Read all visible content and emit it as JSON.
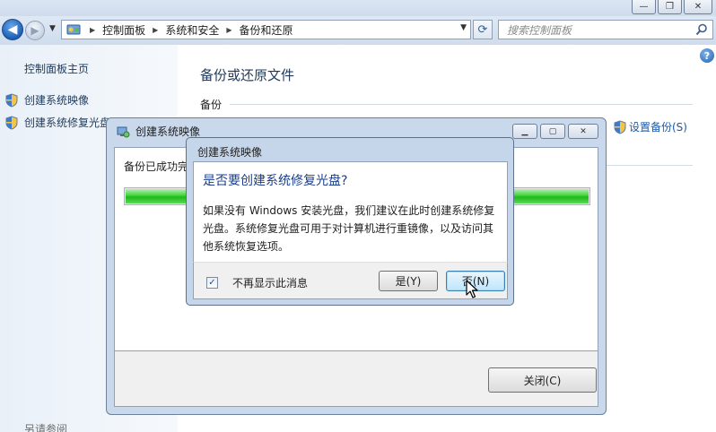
{
  "window": {
    "controls": {
      "minimize": "—",
      "maximize": "❐",
      "close": "✕"
    }
  },
  "nav": {
    "breadcrumbs": [
      "控制面板",
      "系统和安全",
      "备份和还原"
    ],
    "search_placeholder": "搜索控制面板",
    "icons": [
      "back-arrow-icon",
      "forward-arrow-icon",
      "control-panel-icon",
      "refresh-icon",
      "search-icon",
      "help-icon"
    ]
  },
  "sidebar": {
    "home": "控制面板主页",
    "items": [
      {
        "label": "创建系统映像",
        "icon": "uac-shield-icon"
      },
      {
        "label": "创建系统修复光盘",
        "icon": "uac-shield-icon"
      }
    ],
    "see_also": "另请参阅"
  },
  "main": {
    "title": "备份或还原文件",
    "section": "备份",
    "setup_link": "设置备份(S)"
  },
  "progress_dialog": {
    "title": "创建系统映像",
    "status": "备份已成功完",
    "progress": 1.0,
    "close_button": "关闭(C)"
  },
  "confirm_dialog": {
    "title": "创建系统映像",
    "heading": "是否要创建系统修复光盘?",
    "message": "如果没有 Windows 安装光盘，我们建议在此时创建系统修复光盘。系统修复光盘可用于对计算机进行重镜像，以及访问其他系统恢复选项。",
    "checkbox_label": "不再显示此消息",
    "checkbox_checked": true,
    "yes_button": "是(Y)",
    "no_button": "否(N)"
  },
  "colors": {
    "link": "#1e395b",
    "heading": "#1a3e8c",
    "progress_green": "#1fb91a",
    "dialog_frame": "#c6d6ea"
  }
}
